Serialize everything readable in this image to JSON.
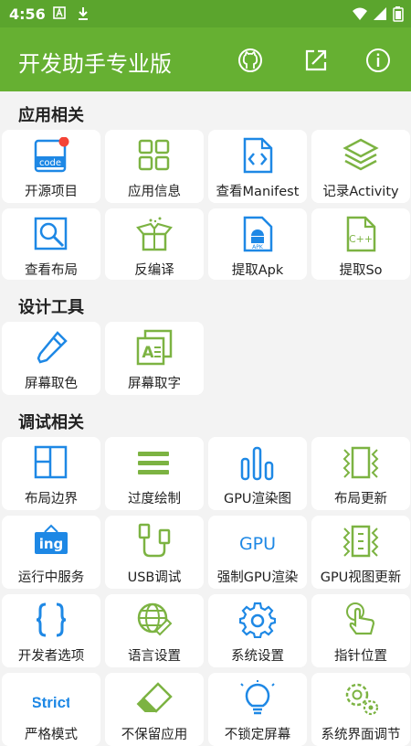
{
  "status_bar": {
    "time": "4:56"
  },
  "app_bar": {
    "title": "开发助手专业版"
  },
  "sections": [
    {
      "title": "应用相关",
      "items": [
        {
          "label": "开源项目",
          "icon": "code-doc-icon",
          "badge": true
        },
        {
          "label": "应用信息",
          "icon": "grid-icon"
        },
        {
          "label": "查看Manifest",
          "icon": "xml-file-icon"
        },
        {
          "label": "记录Activity",
          "icon": "layers-icon"
        },
        {
          "label": "查看布局",
          "icon": "inspect-layout-icon"
        },
        {
          "label": "反编译",
          "icon": "open-box-icon"
        },
        {
          "label": "提取Apk",
          "icon": "apk-file-icon"
        },
        {
          "label": "提取So",
          "icon": "cpp-file-icon"
        }
      ]
    },
    {
      "title": "设计工具",
      "items": [
        {
          "label": "屏幕取色",
          "icon": "dropper-icon"
        },
        {
          "label": "屏幕取字",
          "icon": "text-capture-icon"
        }
      ]
    },
    {
      "title": "调试相关",
      "items": [
        {
          "label": "布局边界",
          "icon": "layout-bounds-icon"
        },
        {
          "label": "过度绘制",
          "icon": "overdraw-icon"
        },
        {
          "label": "GPU渲染图",
          "icon": "bar-graph-icon"
        },
        {
          "label": "布局更新",
          "icon": "layout-update-icon"
        },
        {
          "label": "运行中服务",
          "icon": "running-service-icon",
          "icon_text": "ing"
        },
        {
          "label": "USB调试",
          "icon": "usb-icon"
        },
        {
          "label": "强制GPU渲染",
          "icon": "gpu-text-icon",
          "icon_text": "GPU"
        },
        {
          "label": "GPU视图更新",
          "icon": "gpu-view-icon"
        },
        {
          "label": "开发者选项",
          "icon": "braces-icon"
        },
        {
          "label": "语言设置",
          "icon": "globe-icon"
        },
        {
          "label": "系统设置",
          "icon": "gear-icon"
        },
        {
          "label": "指针位置",
          "icon": "pointer-icon"
        },
        {
          "label": "严格模式",
          "icon": "strict-text-icon",
          "icon_text": "Strict"
        },
        {
          "label": "不保留应用",
          "icon": "eraser-icon"
        },
        {
          "label": "不锁定屏幕",
          "icon": "bulb-icon"
        },
        {
          "label": "系统界面调节",
          "icon": "gears-icon"
        }
      ]
    }
  ],
  "colors": {
    "primary": "#66b032",
    "status_bar": "#5ba52d",
    "blue": "#1e88e5",
    "green": "#7cb342",
    "badge": "#f44336"
  }
}
